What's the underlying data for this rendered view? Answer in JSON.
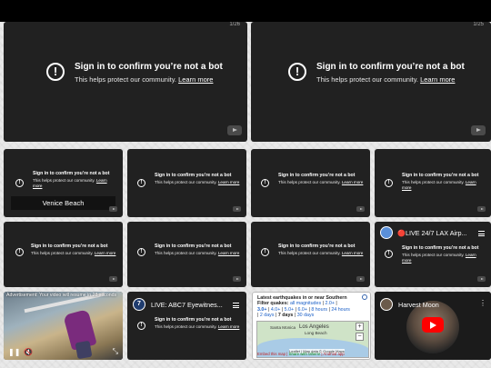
{
  "message": {
    "title": "Sign in to confirm you’re not a bot",
    "sub_prefix": "This helps protect our community.",
    "learn_more": "Learn more",
    "sub_wrap_1": "This helps protect our community. Learn",
    "sub_wrap_2": "more"
  },
  "top_tiles": [
    {
      "counter": "1/26"
    },
    {
      "counter": "1/25"
    }
  ],
  "venice_caption": "Venice Beach",
  "live_tiles": {
    "lax": {
      "title": "🔴LIVE 24/7 LAX Airp..."
    },
    "abc7": {
      "title": "LIVE: ABC7 Eyewitnes...",
      "channel_badge": "7"
    }
  },
  "ad_tile": {
    "notice": "Advertisement: Your video will resume in 28 seconds",
    "play_icon": "pause-icon",
    "mute_icon": "muted-icon",
    "expand_icon": "expand-icon"
  },
  "quake_map": {
    "title": "Latest earthquakes in or near Southern",
    "filter_label": "Filter quakes:",
    "mag_all": "all magnitudes",
    "mag_2": "2.0+",
    "mag_3": "3.0+",
    "mag_4": "4.0+",
    "mag_5": "5.0+",
    "mag_6": "6.0+",
    "t_8h": "8 hours",
    "t_24h": "24 hours",
    "t_2d": "2 days",
    "t_7d": "7 days",
    "t_30d": "30 days",
    "sep": "|",
    "city_la": "Los Angeles",
    "city_lb": "Long Beach",
    "city_sm": "Santa Monica",
    "zoom_in": "+",
    "zoom_out": "−",
    "attribution": "Leaflet | Map data © Google Maps",
    "embed_link": "Embed this map",
    "share_link": "Share with others!",
    "android_link": "Android app"
  },
  "harvest_tile": {
    "title": "Harvest Moon"
  },
  "colors": {
    "tile_bg": "#212121",
    "page_bg": "#e9e9e9",
    "link_blue": "#1a5fc7",
    "yt_red": "#ff0000"
  }
}
